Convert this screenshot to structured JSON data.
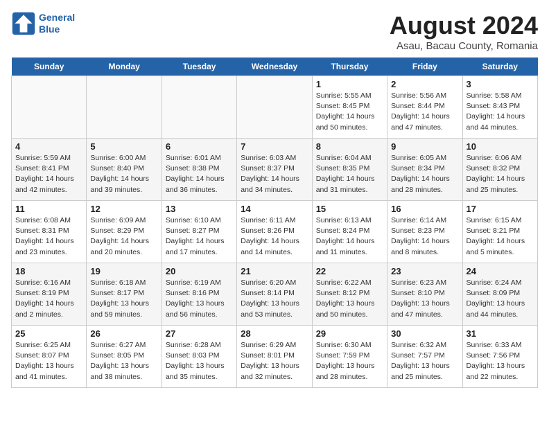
{
  "header": {
    "logo_line1": "General",
    "logo_line2": "Blue",
    "main_title": "August 2024",
    "subtitle": "Asau, Bacau County, Romania"
  },
  "days_of_week": [
    "Sunday",
    "Monday",
    "Tuesday",
    "Wednesday",
    "Thursday",
    "Friday",
    "Saturday"
  ],
  "weeks": [
    [
      {
        "day": "",
        "content": ""
      },
      {
        "day": "",
        "content": ""
      },
      {
        "day": "",
        "content": ""
      },
      {
        "day": "",
        "content": ""
      },
      {
        "day": "1",
        "content": "Sunrise: 5:55 AM\nSunset: 8:45 PM\nDaylight: 14 hours\nand 50 minutes."
      },
      {
        "day": "2",
        "content": "Sunrise: 5:56 AM\nSunset: 8:44 PM\nDaylight: 14 hours\nand 47 minutes."
      },
      {
        "day": "3",
        "content": "Sunrise: 5:58 AM\nSunset: 8:43 PM\nDaylight: 14 hours\nand 44 minutes."
      }
    ],
    [
      {
        "day": "4",
        "content": "Sunrise: 5:59 AM\nSunset: 8:41 PM\nDaylight: 14 hours\nand 42 minutes."
      },
      {
        "day": "5",
        "content": "Sunrise: 6:00 AM\nSunset: 8:40 PM\nDaylight: 14 hours\nand 39 minutes."
      },
      {
        "day": "6",
        "content": "Sunrise: 6:01 AM\nSunset: 8:38 PM\nDaylight: 14 hours\nand 36 minutes."
      },
      {
        "day": "7",
        "content": "Sunrise: 6:03 AM\nSunset: 8:37 PM\nDaylight: 14 hours\nand 34 minutes."
      },
      {
        "day": "8",
        "content": "Sunrise: 6:04 AM\nSunset: 8:35 PM\nDaylight: 14 hours\nand 31 minutes."
      },
      {
        "day": "9",
        "content": "Sunrise: 6:05 AM\nSunset: 8:34 PM\nDaylight: 14 hours\nand 28 minutes."
      },
      {
        "day": "10",
        "content": "Sunrise: 6:06 AM\nSunset: 8:32 PM\nDaylight: 14 hours\nand 25 minutes."
      }
    ],
    [
      {
        "day": "11",
        "content": "Sunrise: 6:08 AM\nSunset: 8:31 PM\nDaylight: 14 hours\nand 23 minutes."
      },
      {
        "day": "12",
        "content": "Sunrise: 6:09 AM\nSunset: 8:29 PM\nDaylight: 14 hours\nand 20 minutes."
      },
      {
        "day": "13",
        "content": "Sunrise: 6:10 AM\nSunset: 8:27 PM\nDaylight: 14 hours\nand 17 minutes."
      },
      {
        "day": "14",
        "content": "Sunrise: 6:11 AM\nSunset: 8:26 PM\nDaylight: 14 hours\nand 14 minutes."
      },
      {
        "day": "15",
        "content": "Sunrise: 6:13 AM\nSunset: 8:24 PM\nDaylight: 14 hours\nand 11 minutes."
      },
      {
        "day": "16",
        "content": "Sunrise: 6:14 AM\nSunset: 8:23 PM\nDaylight: 14 hours\nand 8 minutes."
      },
      {
        "day": "17",
        "content": "Sunrise: 6:15 AM\nSunset: 8:21 PM\nDaylight: 14 hours\nand 5 minutes."
      }
    ],
    [
      {
        "day": "18",
        "content": "Sunrise: 6:16 AM\nSunset: 8:19 PM\nDaylight: 14 hours\nand 2 minutes."
      },
      {
        "day": "19",
        "content": "Sunrise: 6:18 AM\nSunset: 8:17 PM\nDaylight: 13 hours\nand 59 minutes."
      },
      {
        "day": "20",
        "content": "Sunrise: 6:19 AM\nSunset: 8:16 PM\nDaylight: 13 hours\nand 56 minutes."
      },
      {
        "day": "21",
        "content": "Sunrise: 6:20 AM\nSunset: 8:14 PM\nDaylight: 13 hours\nand 53 minutes."
      },
      {
        "day": "22",
        "content": "Sunrise: 6:22 AM\nSunset: 8:12 PM\nDaylight: 13 hours\nand 50 minutes."
      },
      {
        "day": "23",
        "content": "Sunrise: 6:23 AM\nSunset: 8:10 PM\nDaylight: 13 hours\nand 47 minutes."
      },
      {
        "day": "24",
        "content": "Sunrise: 6:24 AM\nSunset: 8:09 PM\nDaylight: 13 hours\nand 44 minutes."
      }
    ],
    [
      {
        "day": "25",
        "content": "Sunrise: 6:25 AM\nSunset: 8:07 PM\nDaylight: 13 hours\nand 41 minutes."
      },
      {
        "day": "26",
        "content": "Sunrise: 6:27 AM\nSunset: 8:05 PM\nDaylight: 13 hours\nand 38 minutes."
      },
      {
        "day": "27",
        "content": "Sunrise: 6:28 AM\nSunset: 8:03 PM\nDaylight: 13 hours\nand 35 minutes."
      },
      {
        "day": "28",
        "content": "Sunrise: 6:29 AM\nSunset: 8:01 PM\nDaylight: 13 hours\nand 32 minutes."
      },
      {
        "day": "29",
        "content": "Sunrise: 6:30 AM\nSunset: 7:59 PM\nDaylight: 13 hours\nand 28 minutes."
      },
      {
        "day": "30",
        "content": "Sunrise: 6:32 AM\nSunset: 7:57 PM\nDaylight: 13 hours\nand 25 minutes."
      },
      {
        "day": "31",
        "content": "Sunrise: 6:33 AM\nSunset: 7:56 PM\nDaylight: 13 hours\nand 22 minutes."
      }
    ]
  ]
}
